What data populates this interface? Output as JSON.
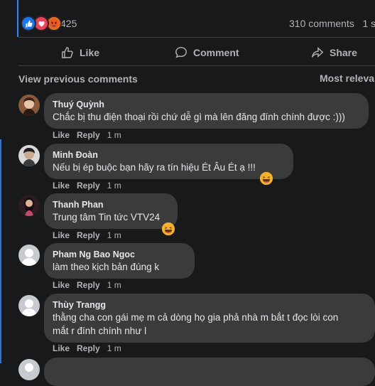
{
  "stats": {
    "reaction_count": "425",
    "comments_count": "310 comments   1 s",
    "reactions": [
      "like-icon",
      "love-icon",
      "angry-icon"
    ]
  },
  "actions": {
    "like": "Like",
    "comment": "Comment",
    "share": "Share"
  },
  "view_previous": "View previous comments",
  "sort_label": "Most relevant",
  "colors": {
    "background": "#18191a",
    "bubble": "#3a3b3c",
    "accent": "#2d88ff",
    "secondary_text": "#b0b3b8"
  },
  "comments": [
    {
      "name": "Thuý Quỳnh",
      "text": [
        "Chắc bị thu điện thoại rồi chứ dễ gì mà lên đăng đính chính được :)))"
      ],
      "like": "Like",
      "reply": "Reply",
      "time": "1 m"
    },
    {
      "name": "Minh Đoàn",
      "text": [
        "Nếu bị ép buộc bạn hãy ra tín hiệu Ét Âu Ét ạ !!!"
      ],
      "like": "Like",
      "reply": "Reply",
      "time": "1 m",
      "reaction": "haha-icon"
    },
    {
      "name": "Thanh Phan",
      "text": [
        "Trung tâm Tin tức VTV24"
      ],
      "like": "Like",
      "reply": "Reply",
      "time": "1 m",
      "reaction": "haha-icon"
    },
    {
      "name": "Pham Ng Bao Ngoc",
      "text": [
        "làm theo kịch bản đúng k"
      ],
      "like": "Like",
      "reply": "Reply",
      "time": "1 m"
    },
    {
      "name": "Thùy Trangg",
      "text": [
        "thằng cha con gái mẹ m cả dòng họ gia phả nhà m bắt t đọc lòi con",
        "mắt r đính chính như l"
      ],
      "like": "Like",
      "reply": "Reply",
      "time": "1 m"
    }
  ]
}
